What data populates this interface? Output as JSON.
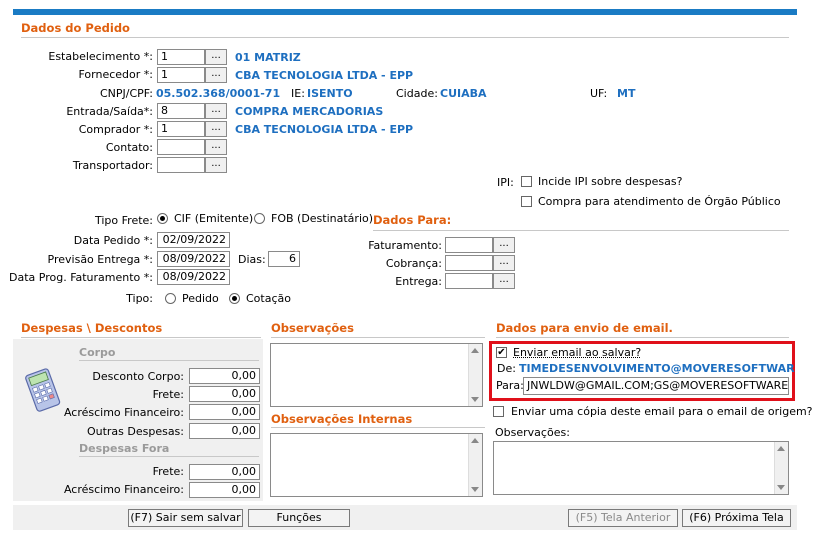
{
  "section_pedido": "Dados do Pedido",
  "estabelecimento": {
    "label": "Estabelecimento *:",
    "value": "1",
    "button": "...",
    "desc": "01 MATRIZ"
  },
  "fornecedor": {
    "label": "Fornecedor *:",
    "value": "1",
    "button": "...",
    "desc": "CBA TECNOLOGIA LTDA - EPP"
  },
  "cnpj": {
    "label": "CNPJ/CPF:",
    "value": "05.502.368/0001-71",
    "ie_label": "IE:",
    "ie_value": "ISENTO",
    "cidade_label": "Cidade:",
    "cidade_value": "CUIABA",
    "uf_label": "UF:",
    "uf_value": "MT"
  },
  "entrada_saida": {
    "label": "Entrada/Saída*:",
    "value": "8",
    "button": "...",
    "desc": "COMPRA MERCADORIAS"
  },
  "comprador": {
    "label": "Comprador *:",
    "value": "1",
    "button": "...",
    "desc": "CBA TECNOLOGIA LTDA - EPP"
  },
  "contato": {
    "label": "Contato:",
    "value": "",
    "button": "..."
  },
  "transportador": {
    "label": "Transportador:",
    "value": "",
    "button": "..."
  },
  "ipi": {
    "label": "IPI:",
    "option1": "Incide IPI sobre despesas?",
    "option2": "Compra para atendimento de Órgão Público"
  },
  "tipo_frete": {
    "label": "Tipo Frete:",
    "option1": "CIF (Emitente)",
    "option2": "FOB (Destinatário)",
    "selected": "CIF (Emitente)"
  },
  "data_pedido": {
    "label": "Data Pedido *:",
    "value": "02/09/2022"
  },
  "previsao_entrega": {
    "label": "Previsão Entrega *:",
    "value": "08/09/2022",
    "dias_label": "Dias:",
    "dias_value": "6"
  },
  "data_prog": {
    "label": "Data Prog. Faturamento *:",
    "value": "08/09/2022"
  },
  "tipo": {
    "label": "Tipo:",
    "option1": "Pedido",
    "option2": "Cotação",
    "selected": "Cotação"
  },
  "dados_para": {
    "title": "Dados Para:",
    "faturamento": "Faturamento:",
    "cobranca": "Cobrança:",
    "entrega": "Entrega:",
    "button": "..."
  },
  "despesas": {
    "title": "Despesas \\ Descontos",
    "corpo": "Corpo",
    "desconto_corpo": {
      "label": "Desconto Corpo:",
      "value": "0,00"
    },
    "frete": {
      "label": "Frete:",
      "value": "0,00"
    },
    "acrescimo": {
      "label": "Acréscimo Financeiro:",
      "value": "0,00"
    },
    "outras": {
      "label": "Outras Despesas:",
      "value": "0,00"
    },
    "fora": "Despesas Fora",
    "frete_fora": {
      "label": "Frete:",
      "value": "0,00"
    },
    "acrescimo_fora": {
      "label": "Acréscimo Financeiro:",
      "value": "0,00"
    }
  },
  "observacoes": {
    "title": "Observações",
    "internas": "Observações Internas"
  },
  "email": {
    "title": "Dados para envio de email.",
    "enviar": "Enviar email ao salvar?",
    "de_label": "De:",
    "de_value": "TIMEDESENVOLVIMENTO@MOVERESOFTWAR",
    "para_label": "Para:",
    "para_value": "JNWLDW@GMAIL.COM;GS@MOVERESOFTWARE.COM",
    "copia": "Enviar uma cópia deste email para o email de origem?",
    "obs_label": "Observações:"
  },
  "footer": {
    "sair": "(F7) Sair sem salvar",
    "funcoes": "Funções",
    "anterior": "(F5) Tela Anterior",
    "proxima": "(F6) Próxima Tela"
  }
}
